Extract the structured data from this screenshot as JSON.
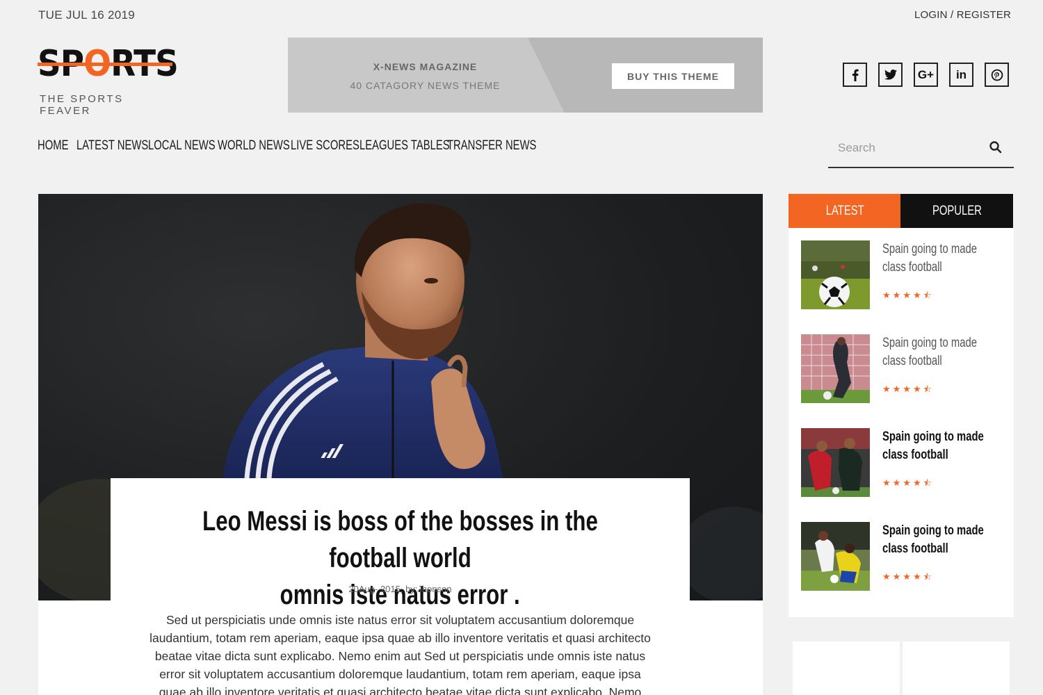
{
  "topbar": {
    "date": "TUE JUL 16 2019",
    "login": "LOGIN / REGISTER"
  },
  "logo": {
    "word_pre": "SP",
    "word_o": "O",
    "word_post": "RTS",
    "tagline": "THE SPORTS FEAVER"
  },
  "banner": {
    "line1": "X-NEWS MAGAZINE",
    "line2": "40 CATAGORY NEWS THEME",
    "button": "BUY THIS THEME"
  },
  "social": [
    {
      "label": "f",
      "icon": "facebook-icon"
    },
    {
      "label": "t",
      "icon": "twitter-icon"
    },
    {
      "label": "G+",
      "icon": "google-plus-icon"
    },
    {
      "label": "in",
      "icon": "linkedin-icon"
    },
    {
      "label": "p",
      "icon": "pinterest-icon"
    }
  ],
  "nav": [
    "HOME",
    "LATEST NEWS",
    "LOCAL NEWS",
    "WORLD NEWS",
    "LIVE SCORES",
    "LEAGUES TABLES",
    "TRANSFER NEWS"
  ],
  "search": {
    "placeholder": "Search",
    "icon": "search-icon"
  },
  "hero": {
    "title_line1": "Leo Messi is boss of the bosses in the football world",
    "title_line2": "omnis iste natus error .",
    "meta": "20Aug- 2015, by:Jhonson",
    "text": "Sed ut perspiciatis unde omnis iste natus error sit voluptatem accusantium doloremque laudantium, totam rem aperiam, eaque ipsa quae ab illo inventore veritatis et quasi architecto beatae vitae dicta sunt explicabo. Nemo enim aut Sed ut perspiciatis unde omnis iste natus error sit voluptatem accusantium doloremque laudantium, totam rem aperiam, eaque ipsa quae ab illo inventore veritatis et quasi architecto beatae vitae dicta sunt explicabo. Nemo"
  },
  "sidebar": {
    "tabs": [
      "LATEST",
      "POPULER"
    ],
    "posts": [
      {
        "title": "Spain going to made class football",
        "rating": 4.5,
        "stars": "★★★★⯪"
      },
      {
        "title": "Spain going to made class football",
        "rating": 4.5,
        "stars": "★★★★⯪"
      },
      {
        "title": "Spain going to made class football",
        "rating": 4.5,
        "stars": "★★★★⯪"
      },
      {
        "title": "Spain going to made class football",
        "rating": 4.5,
        "stars": "★★★★⯪"
      }
    ]
  },
  "colors": {
    "accent": "#f26522",
    "dark": "#111111",
    "background": "#f1f1f1"
  }
}
